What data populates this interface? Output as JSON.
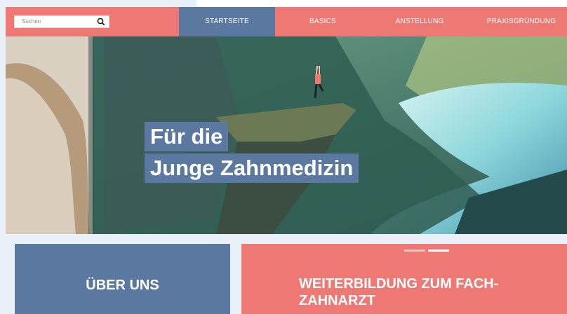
{
  "search": {
    "placeholder": "Suchen"
  },
  "nav": {
    "items": [
      "STARTSEITE",
      "BASICS",
      "ANSTELLUNG",
      "PRAXISGRÜNDUNG"
    ],
    "active_index": 0
  },
  "hero": {
    "line1": "Für die",
    "line2": "Junge Zahnmedizin"
  },
  "cards": {
    "left_title": "ÜBER UNS",
    "right_title_line1": "WEITERBILDUNG ZUM FACH-",
    "right_title_line2": "ZAHNARZT"
  },
  "colors": {
    "brand_coral": "#ee7974",
    "brand_blue": "#5b78a0"
  }
}
